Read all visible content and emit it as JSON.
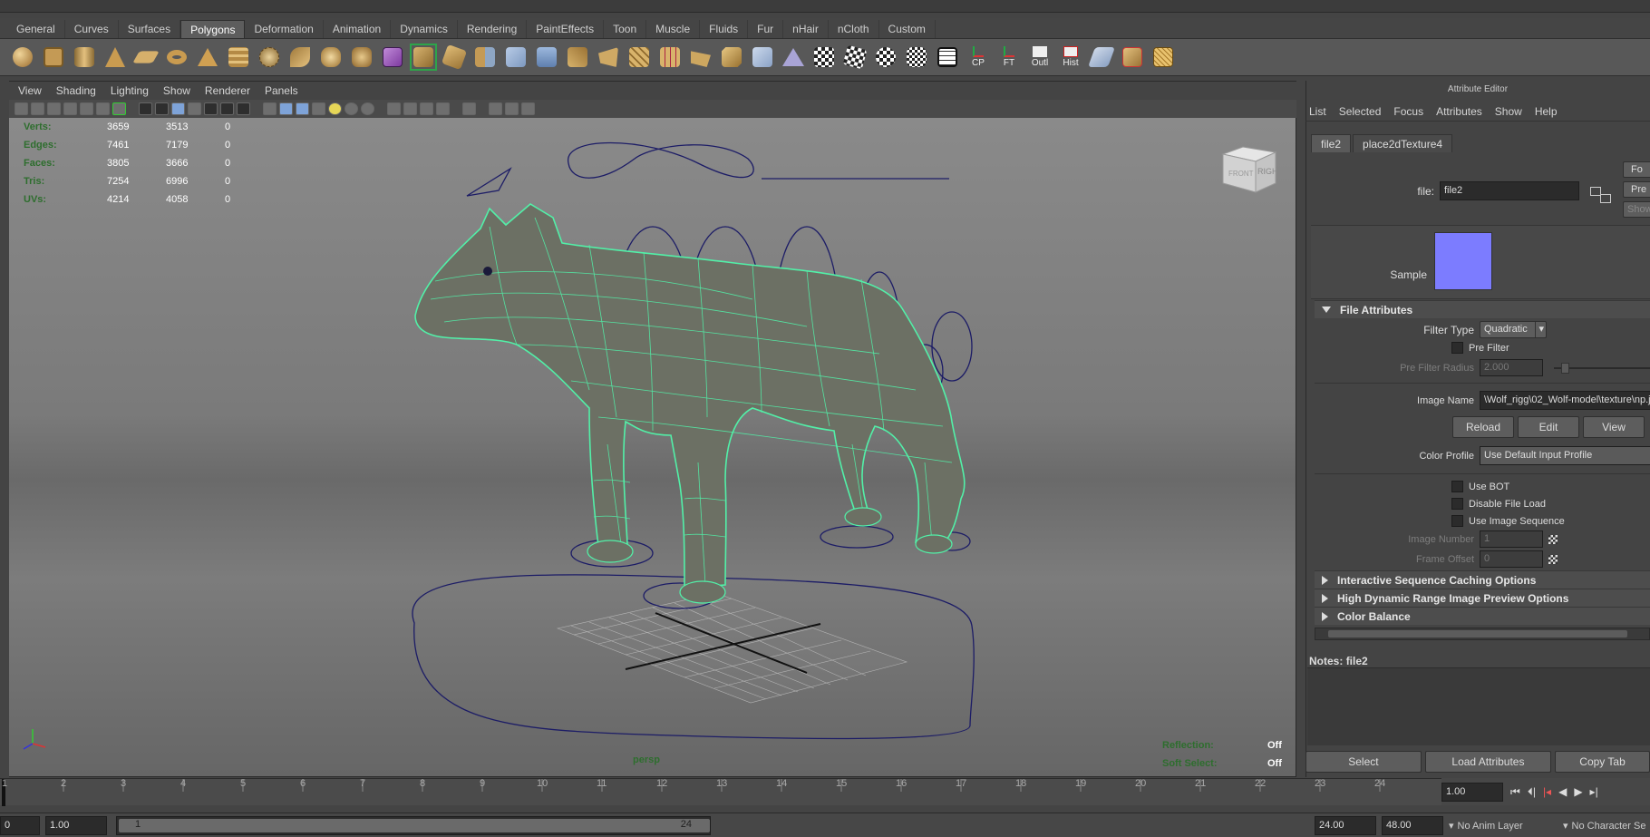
{
  "shelf_tabs": [
    "General",
    "Curves",
    "Surfaces",
    "Polygons",
    "Deformation",
    "Animation",
    "Dynamics",
    "Rendering",
    "PaintEffects",
    "Toon",
    "Muscle",
    "Fluids",
    "Fur",
    "nHair",
    "nCloth",
    "Custom"
  ],
  "shelf_active": "Polygons",
  "shelf_text_icons": [
    "CP",
    "FT",
    "Outl",
    "Hist"
  ],
  "viewport_menu": [
    "View",
    "Shading",
    "Lighting",
    "Show",
    "Renderer",
    "Panels"
  ],
  "hud": {
    "rows": [
      {
        "label": "Verts:",
        "a": "3659",
        "b": "3513",
        "c": "0"
      },
      {
        "label": "Edges:",
        "a": "7461",
        "b": "7179",
        "c": "0"
      },
      {
        "label": "Faces:",
        "a": "3805",
        "b": "3666",
        "c": "0"
      },
      {
        "label": "Tris:",
        "a": "7254",
        "b": "6996",
        "c": "0"
      },
      {
        "label": "UVs:",
        "a": "4214",
        "b": "4058",
        "c": "0"
      }
    ],
    "reflection_label": "Reflection:",
    "reflection_value": "Off",
    "soft_select_label": "Soft Select:",
    "soft_select_value": "Off",
    "camera": "persp"
  },
  "viewcube": {
    "front": "FRONT",
    "right": "RIGHT"
  },
  "attribute_editor": {
    "title": "Attribute Editor",
    "menu": [
      "List",
      "Selected",
      "Focus",
      "Attributes",
      "Show",
      "Help"
    ],
    "tabs": [
      "file2",
      "place2dTexture4"
    ],
    "file_label": "file:",
    "file_value": "file2",
    "side_buttons": [
      "Fo",
      "Pre",
      "Show"
    ],
    "sample_label": "Sample",
    "sample_color": "#7c7cff",
    "file_attributes": "File Attributes",
    "filter_type_label": "Filter Type",
    "filter_type_value": "Quadratic",
    "pre_filter": "Pre Filter",
    "pre_filter_radius_label": "Pre Filter Radius",
    "pre_filter_radius_value": "2.000",
    "image_name_label": "Image Name",
    "image_name_value": "\\Wolf_rigg\\02_Wolf-model\\texture\\np.jpg",
    "reload": "Reload",
    "edit": "Edit",
    "view": "View",
    "color_profile_label": "Color Profile",
    "color_profile_value": "Use Default Input Profile",
    "use_bot": "Use BOT",
    "disable_file_load": "Disable File Load",
    "use_image_sequence": "Use Image Sequence",
    "image_number_label": "Image Number",
    "image_number_value": "1",
    "frame_offset_label": "Frame Offset",
    "frame_offset_value": "0",
    "sections": [
      "Interactive Sequence Caching Options",
      "High Dynamic Range Image Preview Options",
      "Color Balance"
    ],
    "notes_label": "Notes:",
    "notes_value": "file2",
    "bottom_buttons": [
      "Select",
      "Load Attributes",
      "Copy Tab"
    ]
  },
  "timeline": {
    "ticks": [
      "1",
      "2",
      "3",
      "4",
      "5",
      "6",
      "7",
      "8",
      "9",
      "10",
      "11",
      "12",
      "13",
      "14",
      "15",
      "16",
      "17",
      "18",
      "19",
      "20",
      "21",
      "22",
      "23",
      "24"
    ],
    "current": "1.00"
  },
  "range": {
    "start_outer": "0",
    "start": "1.00",
    "slider_start": "1",
    "slider_end": "24",
    "end": "24.00",
    "end_outer": "48.00",
    "anim_layer": "No Anim Layer",
    "character_set": "No Character Se"
  },
  "colors": {
    "hud_label": "#2e6e2e",
    "wire": "#52f0a8",
    "curve": "#1c1c66",
    "accent": "#7c7cff"
  }
}
